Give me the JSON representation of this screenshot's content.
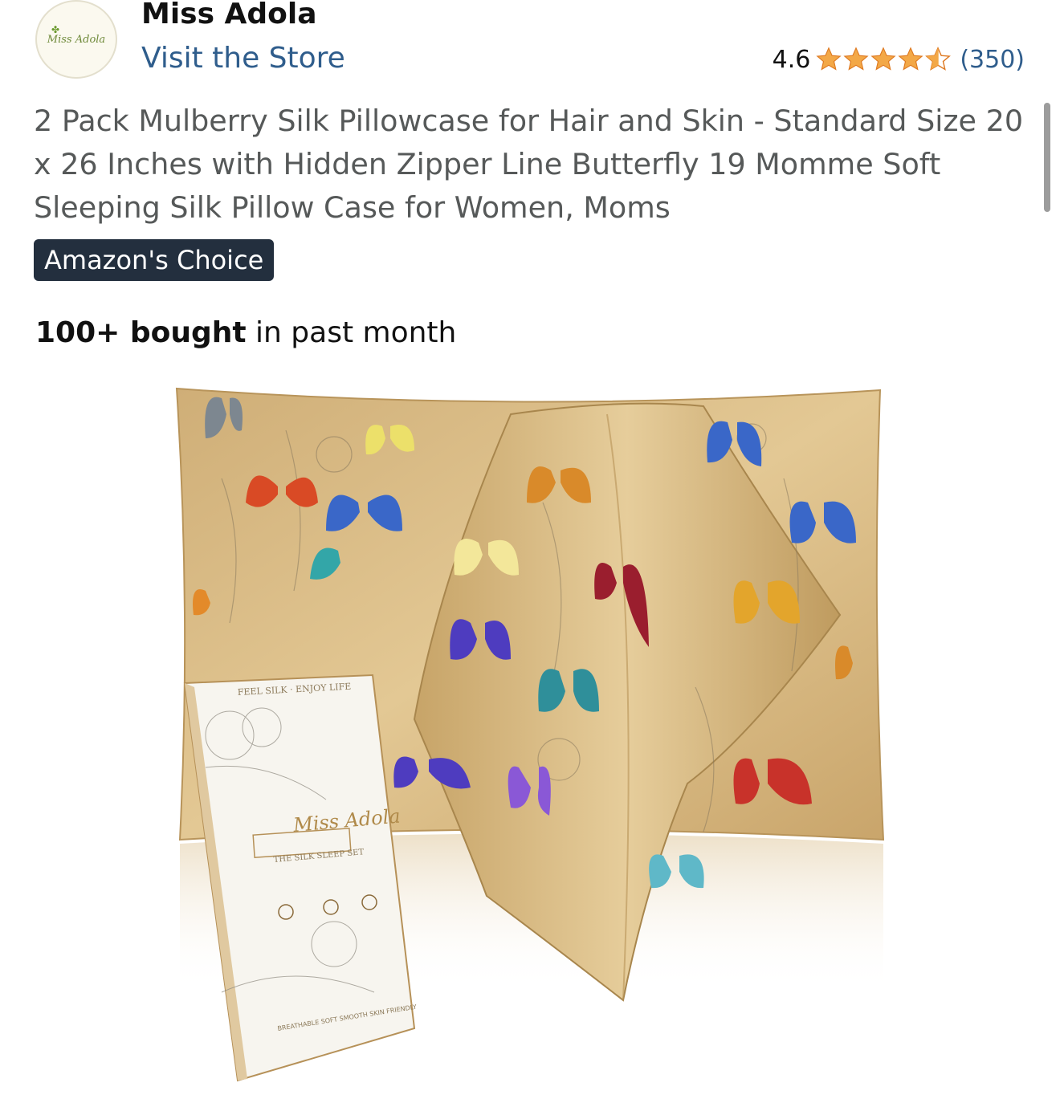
{
  "store": {
    "logo_text": "Miss Adola",
    "brand_name": "Miss Adola",
    "visit_link": "Visit the Store"
  },
  "rating": {
    "value": "4.6",
    "stars": 4.6,
    "review_count": "(350)",
    "star_color": "#f3a847"
  },
  "product": {
    "title": "2 Pack Mulberry Silk Pillowcase for Hair and Skin - Standard Size 20 x 26 Inches with Hidden Zipper Line Butterfly 19 Momme Soft Sleeping Silk Pillow Case for Women, Moms",
    "badge": "Amazon's Choice",
    "bought_bold": "100+ bought",
    "bought_rest": " in past month"
  },
  "image": {
    "box_top_text": "FEEL SILK · ENJOY LIFE",
    "box_brand": "Miss Adola",
    "box_subtitle": "THE SILK SLEEP SET",
    "box_bottom_text": "BREATHABLE SOFT SMOOTH SKIN FRIENDLY"
  },
  "colors": {
    "link": "#2f5d8c",
    "badge_bg": "#232f3e",
    "title_text": "#565959",
    "fabric": "#d9b980"
  }
}
